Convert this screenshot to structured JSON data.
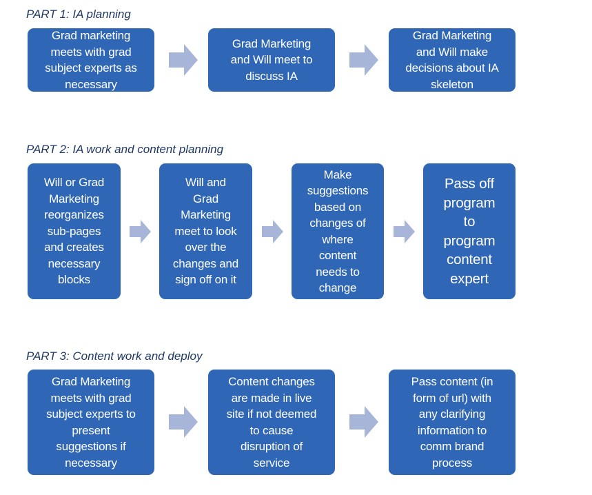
{
  "colors": {
    "box": "#2f66b5",
    "arrow": "#a7b6d8",
    "title": "#1f3864"
  },
  "parts": [
    {
      "title": "PART 1: IA planning",
      "steps": [
        "Grad marketing\nmeets with grad\nsubject experts as\nnecessary",
        "Grad Marketing\nand Will meet to\ndiscuss IA",
        "Grad Marketing\nand Will make\ndecisions about IA\nskeleton"
      ]
    },
    {
      "title": "PART 2: IA work and content planning",
      "steps": [
        "Will or Grad\nMarketing\nreorganizes\nsub-pages\nand creates\nnecessary\nblocks",
        "Will and\nGrad\nMarketing\nmeet to look\nover the\nchanges and\nsign off on it",
        "Make\nsuggestions\nbased on\nchanges of\nwhere\ncontent\nneeds to\nchange",
        "Pass off\nprogram\nto\nprogram\ncontent\nexpert"
      ]
    },
    {
      "title": "PART 3: Content work and deploy",
      "steps": [
        "Grad Marketing\nmeets with grad\nsubject experts to\npresent\nsuggestions if\nnecessary",
        "Content changes\nare made in live\nsite if not deemed\nto cause\ndisruption of\nservice",
        "Pass content (in\nform of url) with\nany clarifying\ninformation to\ncomm brand\nprocess"
      ]
    }
  ]
}
